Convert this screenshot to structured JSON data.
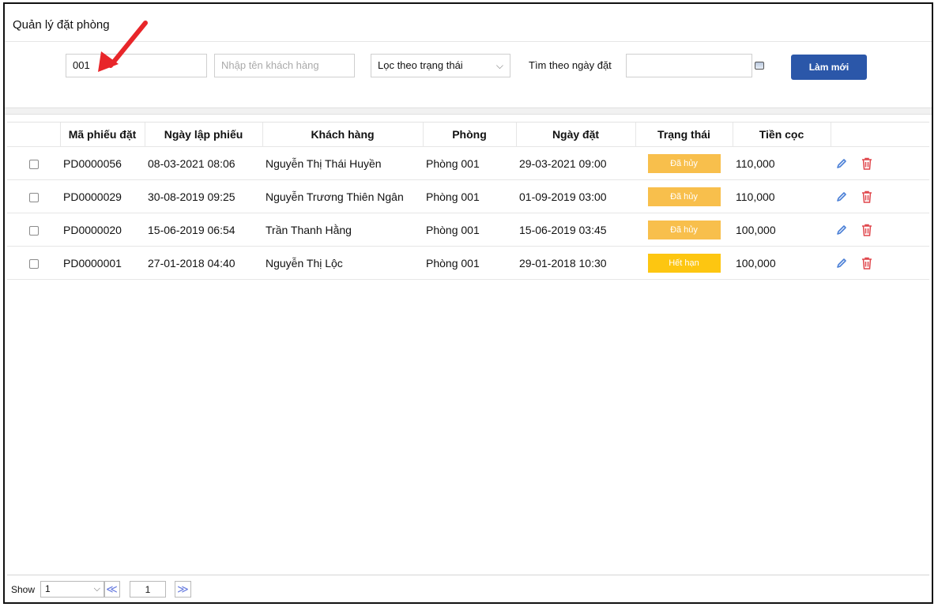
{
  "page": {
    "title": "Quản lý đặt phòng"
  },
  "filters": {
    "code_value": "001",
    "name_placeholder": "Nhập tên khách hàng",
    "status_selected": "Lọc theo trạng thái",
    "date_label": "Tìm theo ngày đặt",
    "date_value": "",
    "refresh_label": "Làm mới"
  },
  "table": {
    "columns": [
      "",
      "Mã phiếu đặt",
      "Ngày lập phiếu",
      "Khách hàng",
      "Phòng",
      "Ngày đặt",
      "Trạng thái",
      "Tiền cọc",
      ""
    ],
    "rows": [
      {
        "code": "PD0000056",
        "created": "08-03-2021 08:06",
        "customer": "Nguyễn Thị Thái Huyền",
        "room": "Phòng 001",
        "booking_date": "29-03-2021 09:00",
        "status": "Đã hủy",
        "status_kind": "cancel",
        "deposit": "110,000"
      },
      {
        "code": "PD0000029",
        "created": "30-08-2019 09:25",
        "customer": "Nguyễn Trương Thiên Ngân",
        "room": "Phòng 001",
        "booking_date": "01-09-2019 03:00",
        "status": "Đã hủy",
        "status_kind": "cancel",
        "deposit": "110,000"
      },
      {
        "code": "PD0000020",
        "created": "15-06-2019 06:54",
        "customer": "Trần Thanh Hằng",
        "room": "Phòng 001",
        "booking_date": "15-06-2019 03:45",
        "status": "Đã hủy",
        "status_kind": "cancel",
        "deposit": "100,000"
      },
      {
        "code": "PD0000001",
        "created": "27-01-2018 04:40",
        "customer": "Nguyễn Thị Lộc",
        "room": "Phòng 001",
        "booking_date": "29-01-2018 10:30",
        "status": "Hết hạn",
        "status_kind": "expired",
        "deposit": "100,000"
      }
    ]
  },
  "pagination": {
    "show_label": "Show",
    "page_size": "1",
    "current_page": "1",
    "prev_glyph": "≪",
    "next_glyph": "≫"
  },
  "colors": {
    "accent": "#2b57a9",
    "status_cancel": "#f8bf4c",
    "status_expired": "#fdc611",
    "edit_icon": "#4a7fd6",
    "delete_icon": "#e0474c",
    "annotation_arrow": "#e8262a"
  },
  "icons": {
    "calendar": "calendar-icon",
    "edit": "pencil-icon",
    "delete": "trash-icon",
    "dropdown": "chevron-down-icon"
  }
}
